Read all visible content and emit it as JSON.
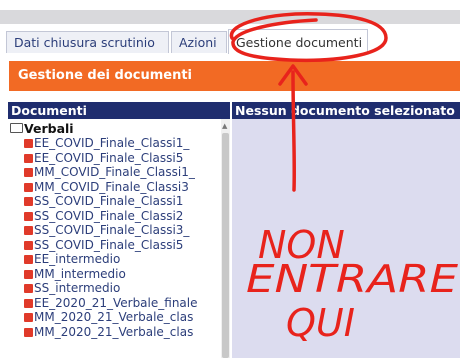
{
  "tabs": [
    {
      "label": "Dati chiusura scrutinio"
    },
    {
      "label": "Azioni"
    },
    {
      "label": "Gestione documenti",
      "active": true
    }
  ],
  "section_banner": {
    "title": "Gestione dei documenti"
  },
  "columns": {
    "left_header": "Documenti",
    "right_header": "Nessun documento selezionato"
  },
  "tree": {
    "folder": "Verbali",
    "items": [
      "EE_COVID_Finale_Classi1_",
      "EE_COVID_Finale_Classi5",
      "MM_COVID_Finale_Classi1_",
      "MM_COVID_Finale_Classi3",
      "SS_COVID_Finale_Classi1",
      "SS_COVID_Finale_Classi2",
      "SS_COVID_Finale_Classi3_",
      "SS_COVID_Finale_Classi5",
      "EE_intermedio",
      "MM_intermedio",
      "SS_intermedio",
      "EE_2020_21_Verbale_finale",
      "MM_2020_21_Verbale_clas",
      "MM_2020_21_Verbale_clas"
    ]
  },
  "annotation": {
    "lines": [
      "NON",
      "ENTRARE",
      "QUI"
    ],
    "color": "#e8231c"
  },
  "colors": {
    "banner": "#f26a24",
    "column_header": "#1f2d6e",
    "right_panel": "#dcdcef",
    "file_icon": "#e03a2a"
  },
  "icons": {
    "folder": "folder-open-icon",
    "document": "pdf-file-icon"
  }
}
